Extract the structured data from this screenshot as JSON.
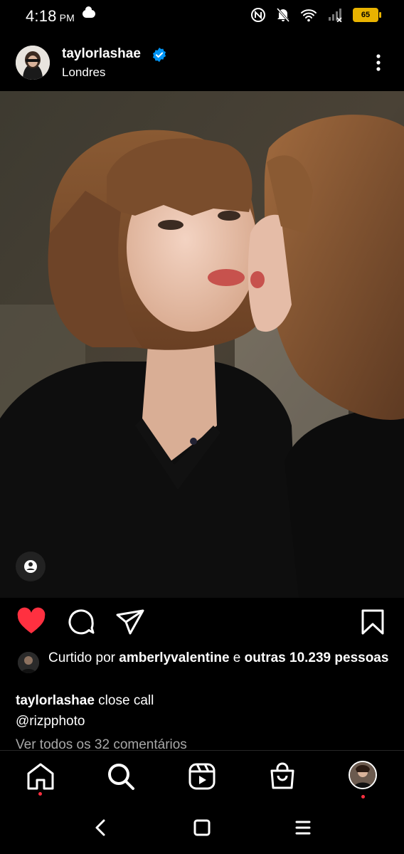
{
  "status_bar": {
    "time": "4:18",
    "ampm": "PM",
    "battery": "65"
  },
  "post": {
    "username": "taylorlashae",
    "location": "Londres",
    "likes": {
      "prefix": "Curtido por ",
      "liked_by": "amberlyvalentine",
      "joiner": " e ",
      "others": "outras 10.239 pessoas"
    },
    "caption": {
      "username": "taylorlashae",
      "text": " close call",
      "mention": "@rizpphoto"
    },
    "comments_link": "Ver todos os 32 comentários"
  },
  "colors": {
    "like_red": "#ff3040",
    "verified_blue": "#0095f6",
    "battery_yellow": "#e9b300"
  },
  "icons": {
    "actions": [
      "heart-icon",
      "comment-icon",
      "share-icon",
      "bookmark-icon"
    ],
    "nav": [
      "home-icon",
      "search-icon",
      "reels-icon",
      "shop-icon",
      "profile-avatar"
    ],
    "system": [
      "back-icon",
      "home-square-icon",
      "recents-icon"
    ]
  }
}
